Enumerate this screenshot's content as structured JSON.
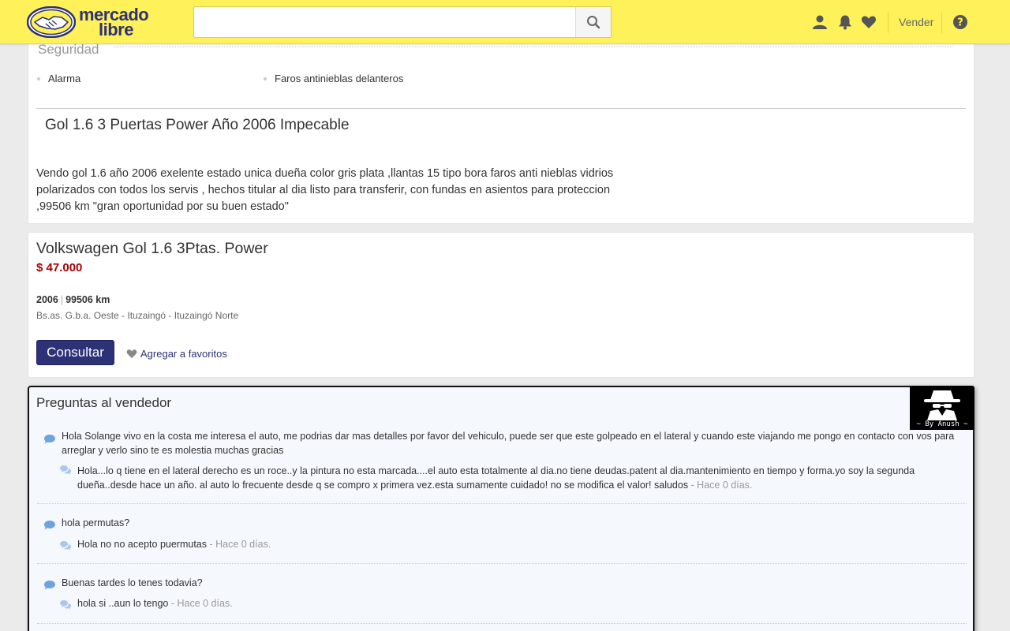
{
  "header": {
    "logo_line1": "mercado",
    "logo_line2": "libre",
    "search_placeholder": "",
    "vender_label": "Vender",
    "colors": {
      "bar": "#fff159",
      "brand": "#2d3277"
    },
    "icons": [
      "user-icon",
      "bell-icon",
      "heart-icon",
      "help-icon"
    ]
  },
  "description": {
    "section_title": "Seguridad",
    "features": [
      "Alarma",
      "Faros antinieblas delanteros"
    ],
    "title": "Gol 1.6 3 Puertas Power Año 2006 Impecable",
    "body": "Vendo gol 1.6 año 2006 exelente estado unica dueña color gris plata ,llantas 15 tipo bora faros anti nieblas vidrios polarizados con todos los servis , hechos titular al dia listo para transferir, con fundas en asientos para proteccion ,99506 km \"gran oportunidad por su buen estado\""
  },
  "item": {
    "title": "Volkswagen Gol 1.6 3Ptas. Power",
    "price": "$ 47.000",
    "year": "2006",
    "km": "99506 km",
    "location": "Bs.as. G.b.a. Oeste - Ituzaingó - Ituzaingó Norte",
    "consultar_label": "Consultar",
    "favorite_label": "Agregar a favoritos",
    "colors": {
      "price": "#a00000",
      "button": "#2d3277"
    }
  },
  "questions": {
    "title": "Preguntas al vendedor",
    "badge_caption": "~ By Anush ~",
    "items": [
      {
        "question": "Hola Solange vivo en la costa me interesa el auto, me podrias dar mas detalles por favor del vehiculo, puede ser que este golpeado en el lateral y cuando este viajando me pongo en contacto con vos para arreglar y verlo sino te es molestia muchas gracias",
        "answer": "Hola...lo q tiene en el lateral derecho es un roce..y la pintura no esta marcada....el auto esta totalmente al dia.no tiene deudas.patent al dia.mantenimiento en tiempo y forma.yo soy la segunda dueña..desde hace un año. al auto lo frecuente desde q se compro x primera vez.esta sumamente cuidado! no se modifica el valor! saludos",
        "time": " - Hace 0 días."
      },
      {
        "question": "hola permutas?",
        "answer": "Hola no no acepto puermutas",
        "time": " - Hace 0 días."
      },
      {
        "question": "Buenas tardes lo tenes todavia?",
        "answer": "hola si ..aun lo tengo",
        "time": " - Hace 0 días."
      }
    ]
  }
}
